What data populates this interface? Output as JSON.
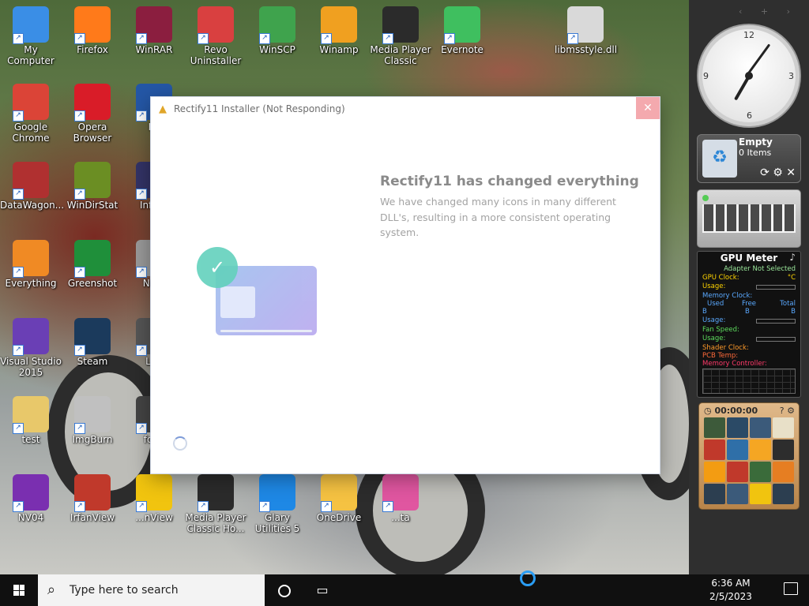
{
  "desktop": {
    "icons": [
      {
        "label": "My Computer"
      },
      {
        "label": "Firefox"
      },
      {
        "label": "WinRAR"
      },
      {
        "label": "Revo Uninstaller"
      },
      {
        "label": "WinSCP"
      },
      {
        "label": "Winamp"
      },
      {
        "label": "Media Player Classic"
      },
      {
        "label": "Evernote"
      },
      {
        "label": "libmsstyle.dll"
      },
      {
        "label": "Google Chrome"
      },
      {
        "label": "Opera Browser"
      },
      {
        "label": "Pu"
      },
      {
        "label": "DataWagon..."
      },
      {
        "label": "WinDirStat"
      },
      {
        "label": "InfraR"
      },
      {
        "label": "Everything"
      },
      {
        "label": "Greenshot"
      },
      {
        "label": "Note"
      },
      {
        "label": "Visual Studio 2015"
      },
      {
        "label": "Steam"
      },
      {
        "label": "Lau"
      },
      {
        "label": "test"
      },
      {
        "label": "ImgBurn"
      },
      {
        "label": "foob"
      },
      {
        "label": "NV04"
      },
      {
        "label": "IrfanView"
      },
      {
        "label": "...nView"
      },
      {
        "label": "Media Player Classic Ho..."
      },
      {
        "label": "Glary Utilities 5"
      },
      {
        "label": "OneDrive"
      },
      {
        "label": "...ta"
      }
    ]
  },
  "installer": {
    "title": "Rectify11 Installer (Not Responding)",
    "close_glyph": "✕",
    "heading": "Rectify11 has changed everything",
    "description": "We have changed many icons in many different DLL's, resulting in a more consistent operating system."
  },
  "sidebar": {
    "nav_glyphs": "‹ + ›",
    "clock": {
      "n12": "12",
      "n3": "3",
      "n6": "6",
      "n9": "9",
      "hour_deg": 210,
      "minute_deg": 36
    },
    "recycle_bin": {
      "status": "Empty",
      "items": "0 Items"
    },
    "gpu_meter": {
      "title": "GPU Meter",
      "adapter": "Adapter Not Selected",
      "gpu_clock": "GPU Clock:",
      "gpu_clock_unit": "°C",
      "usage": "Usage:",
      "memory_clock": "Memory Clock:",
      "used": "Used",
      "free": "Free",
      "total": "Total",
      "b": "B",
      "fan_speed": "Fan Speed:",
      "shader_clock": "Shader Clock:",
      "pcb_temp": "PCB Temp:",
      "memory_controller": "Memory Controller:"
    },
    "puzzle": {
      "timer": "00:00:00"
    }
  },
  "taskbar": {
    "search_placeholder": "Type here to search",
    "time": "6:36 AM",
    "date": "2/5/2023"
  },
  "colors": {
    "accent": "#2a9df4",
    "close_button": "#f4a9ae",
    "heading": "#8a8a8a"
  }
}
